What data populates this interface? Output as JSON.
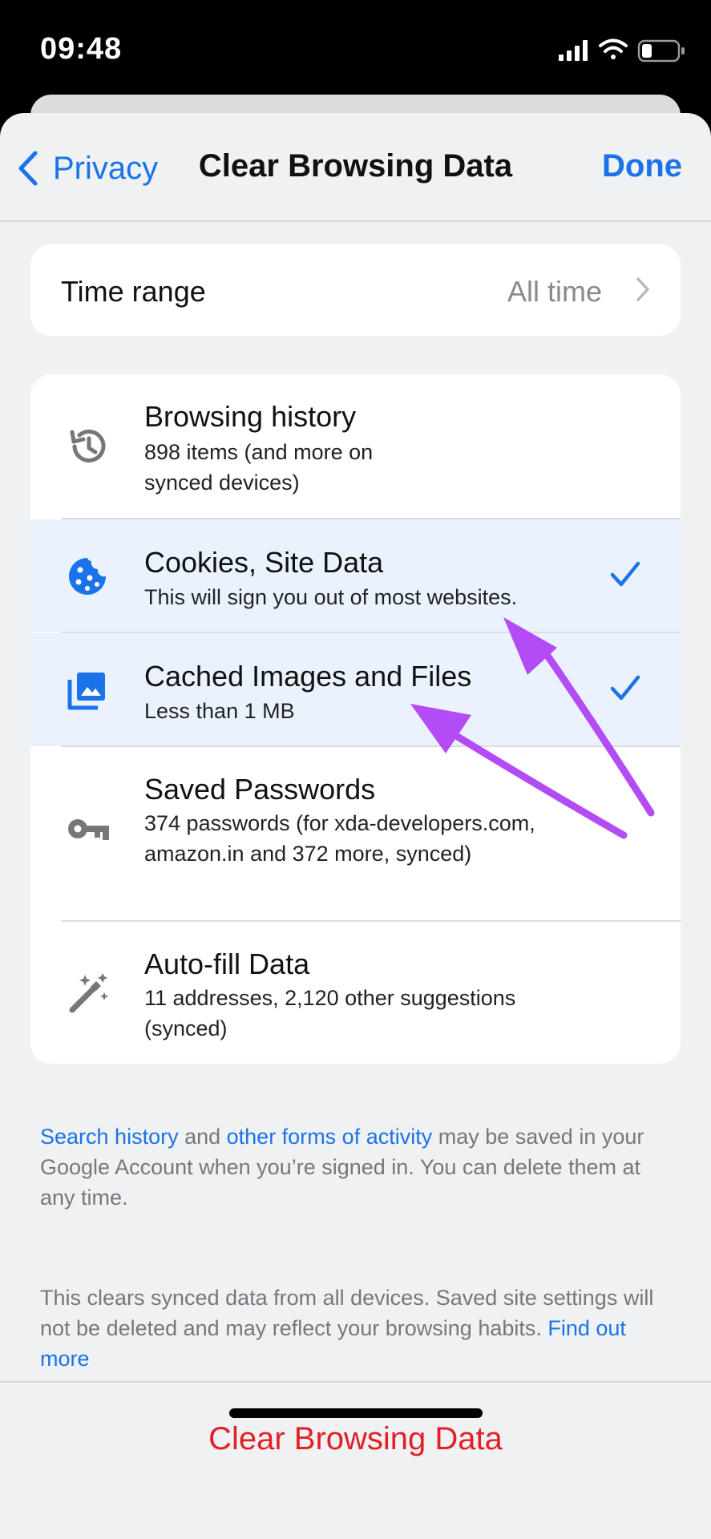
{
  "status_bar": {
    "time": "09:48"
  },
  "nav": {
    "back_label": "Privacy",
    "title": "Clear Browsing Data",
    "done_label": "Done"
  },
  "time_range": {
    "label": "Time range",
    "value": "All time"
  },
  "items": [
    {
      "title": "Browsing history",
      "subtitle": "898 items (and more on synced devices)",
      "icon": "history-icon",
      "checked": false
    },
    {
      "title": "Cookies, Site Data",
      "subtitle": "This will sign you out of most websites.",
      "icon": "cookie-icon",
      "checked": true
    },
    {
      "title": "Cached Images and Files",
      "subtitle": "Less than 1 MB",
      "icon": "image-icon",
      "checked": true
    },
    {
      "title": "Saved Passwords",
      "subtitle": "374 passwords (for xda-developers.com, amazon.in and 372 more, synced)",
      "icon": "key-icon",
      "checked": false
    },
    {
      "title": "Auto-fill Data",
      "subtitle": "11 addresses, 2,120 other suggestions (synced)",
      "icon": "magic-wand-icon",
      "checked": false
    }
  ],
  "info1": {
    "link1": "Search history",
    "text1": " and ",
    "link2": "other forms of activity",
    "text2": " may be saved in your Google Account when you’re signed in. You can delete them at any time."
  },
  "info2": {
    "text": "This clears synced data from all devices. Saved site settings will not be deleted and may reflect your browsing habits. ",
    "link": "Find out more"
  },
  "clear_button": "Clear Browsing Data",
  "colors": {
    "accent": "#1a73e8",
    "danger": "#e31f26",
    "annotation_arrow": "#b44cf5",
    "selected_row": "#eaf3fd"
  }
}
